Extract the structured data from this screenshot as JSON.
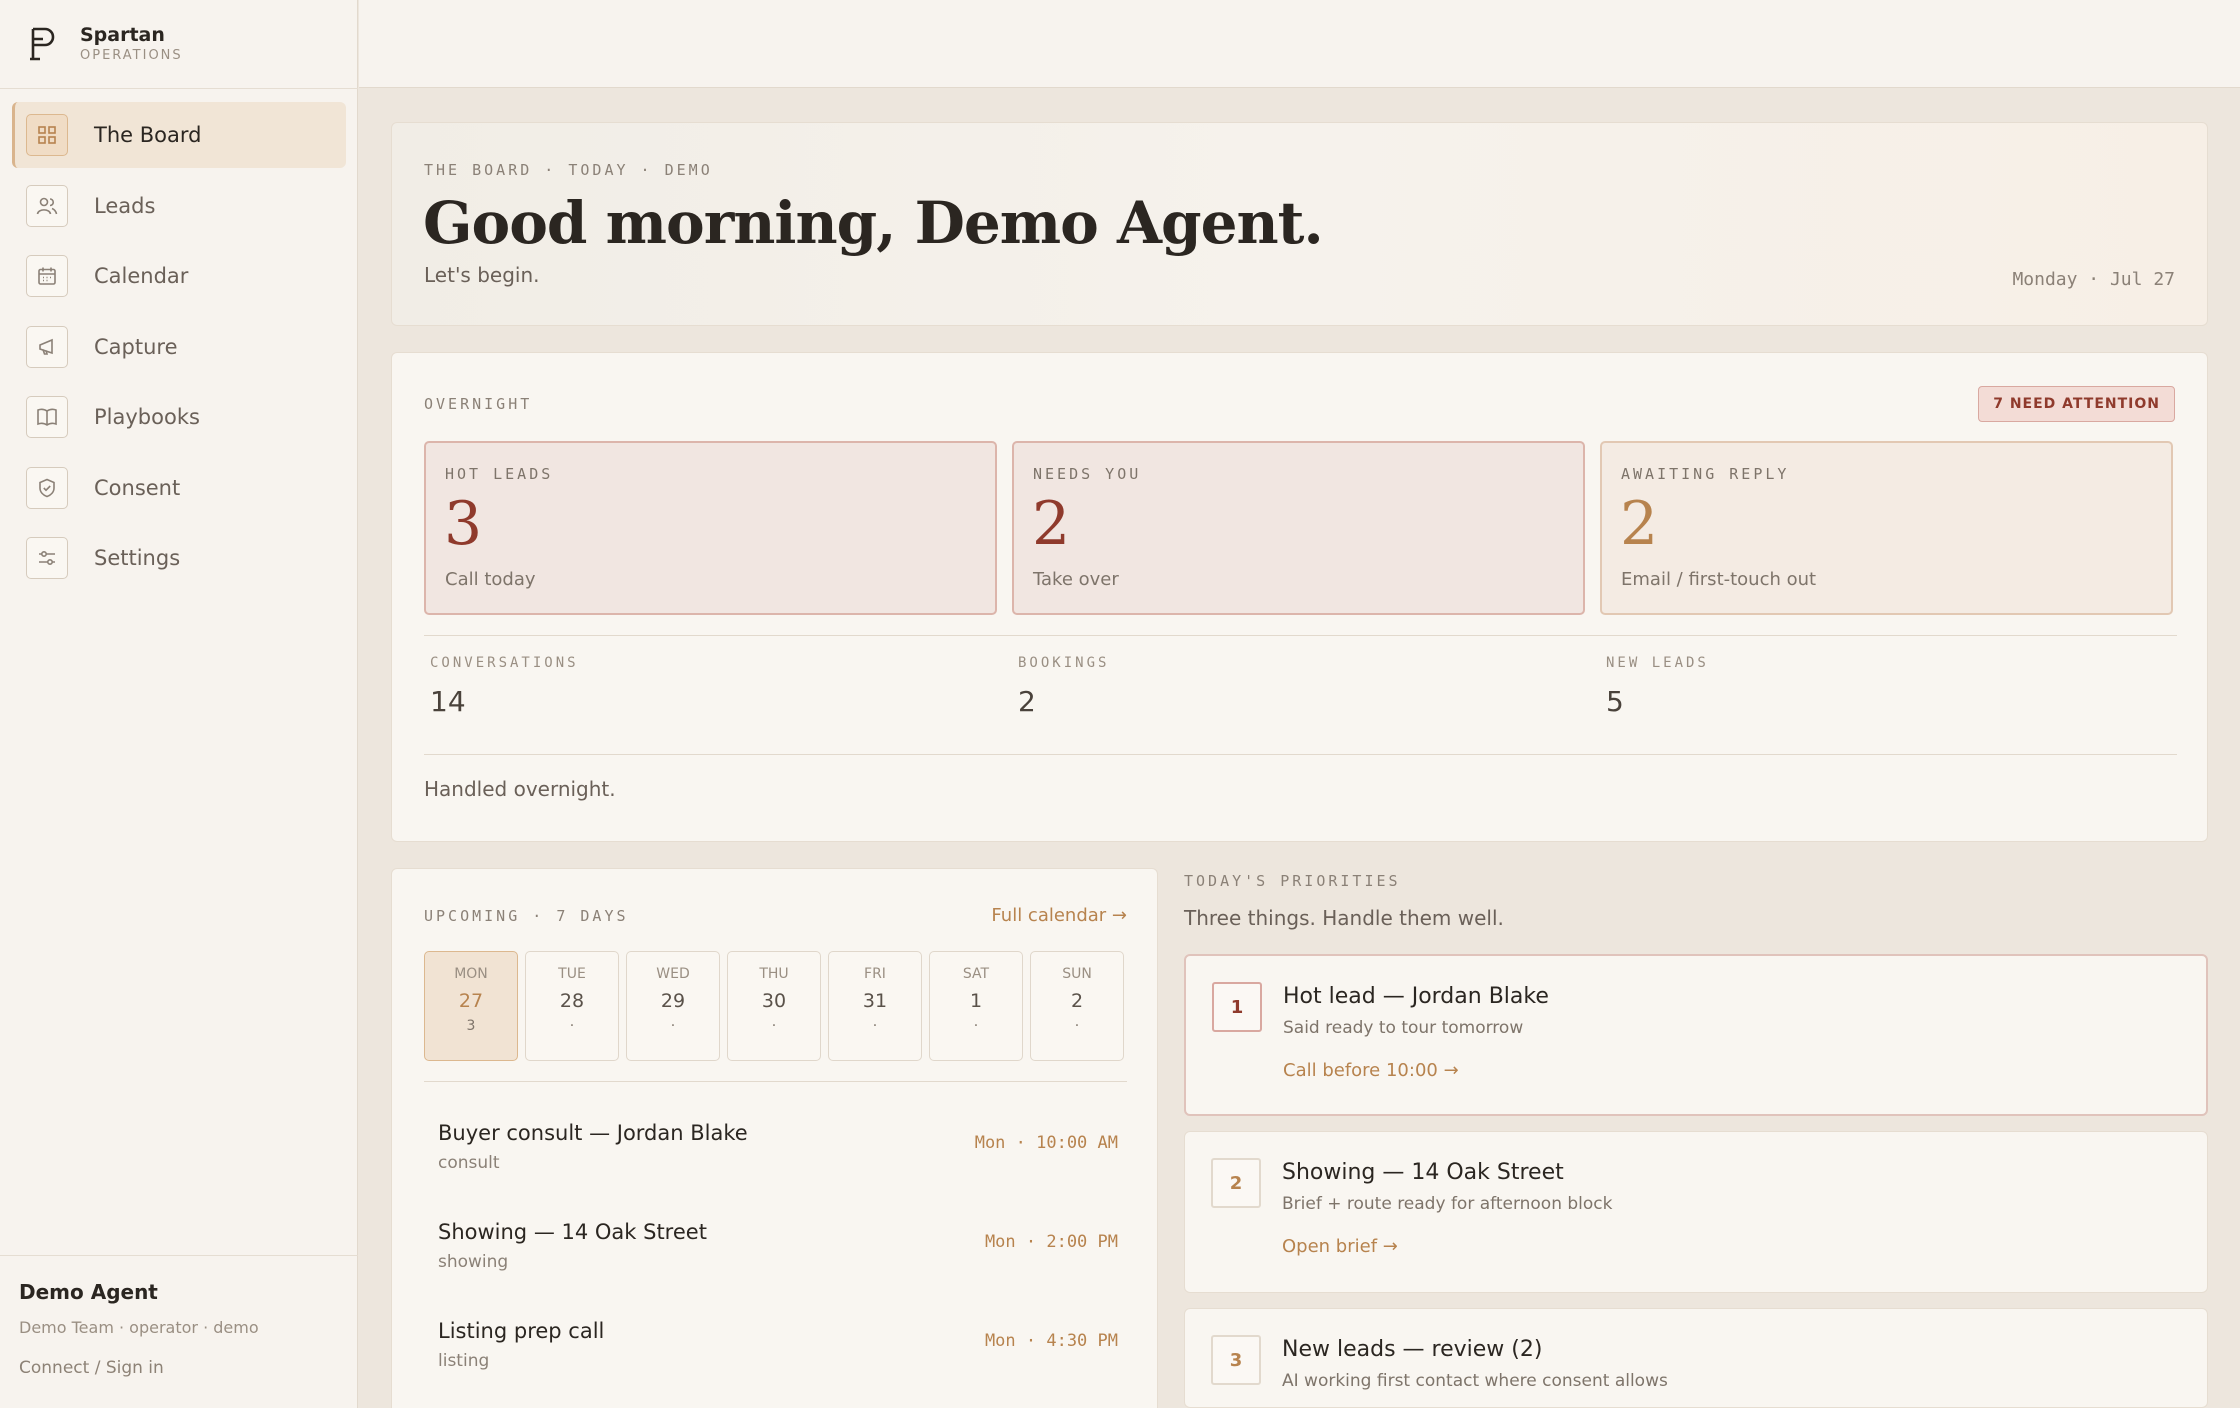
{
  "brand": {
    "name": "Spartan",
    "subtitle": "OPERATIONS",
    "logo_icon": "spartan-logo"
  },
  "nav": [
    {
      "label": "The Board",
      "icon": "grid-icon",
      "active": true
    },
    {
      "label": "Leads",
      "icon": "users-icon"
    },
    {
      "label": "Calendar",
      "icon": "calendar-icon"
    },
    {
      "label": "Capture",
      "icon": "megaphone-icon"
    },
    {
      "label": "Playbooks",
      "icon": "book-icon"
    },
    {
      "label": "Consent",
      "icon": "shield-icon"
    },
    {
      "label": "Settings",
      "icon": "sliders-icon"
    }
  ],
  "user": {
    "name": "Demo Agent",
    "meta": "Demo Team · operator · demo",
    "link": "Connect / Sign in"
  },
  "hero": {
    "eyebrow": "THE BOARD · TODAY · DEMO",
    "title": "Good morning, Demo Agent.",
    "subtitle": "Let's begin.",
    "date": "Monday · Jul 27"
  },
  "overnight": {
    "eyebrow": "OVERNIGHT",
    "badge": "7 NEED ATTENTION",
    "stats": [
      {
        "label": "HOT LEADS",
        "value": "3",
        "desc": "Call today"
      },
      {
        "label": "NEEDS YOU",
        "value": "2",
        "desc": "Take over"
      },
      {
        "label": "AWAITING REPLY",
        "value": "2",
        "desc": "Email / first-touch out"
      }
    ],
    "metrics": [
      {
        "label": "CONVERSATIONS",
        "value": "14"
      },
      {
        "label": "BOOKINGS",
        "value": "2"
      },
      {
        "label": "NEW LEADS",
        "value": "5"
      }
    ],
    "footer": "Handled overnight."
  },
  "upcoming": {
    "eyebrow": "UPCOMING · 7 DAYS",
    "link": "Full calendar →",
    "days": [
      {
        "name": "MON",
        "num": "27",
        "count": "3",
        "active": true
      },
      {
        "name": "TUE",
        "num": "28",
        "count": "·"
      },
      {
        "name": "WED",
        "num": "29",
        "count": "·"
      },
      {
        "name": "THU",
        "num": "30",
        "count": "·"
      },
      {
        "name": "FRI",
        "num": "31",
        "count": "·"
      },
      {
        "name": "SAT",
        "num": "1",
        "count": "·"
      },
      {
        "name": "SUN",
        "num": "2",
        "count": "·"
      }
    ],
    "events": [
      {
        "title": "Buyer consult — Jordan Blake",
        "type": "consult",
        "time": "Mon · 10:00 AM"
      },
      {
        "title": "Showing — 14 Oak Street",
        "type": "showing",
        "time": "Mon · 2:00 PM"
      },
      {
        "title": "Listing prep call",
        "type": "listing",
        "time": "Mon · 4:30 PM"
      }
    ]
  },
  "priorities": {
    "eyebrow": "TODAY'S PRIORITIES",
    "subtitle": "Three things. Handle them well.",
    "items": [
      {
        "num": "1",
        "title": "Hot lead — Jordan Blake",
        "desc": "Said ready to tour tomorrow",
        "action": "Call before 10:00 →"
      },
      {
        "num": "2",
        "title": "Showing — 14 Oak Street",
        "desc": "Brief + route ready for afternoon block",
        "action": "Open brief →"
      },
      {
        "num": "3",
        "title": "New leads — review (2)",
        "desc": "AI working first contact where consent allows",
        "action": ""
      }
    ]
  },
  "colors": {
    "accent": "#b7834e",
    "alert": "#8f3a2c",
    "background": "#ede6dd"
  }
}
